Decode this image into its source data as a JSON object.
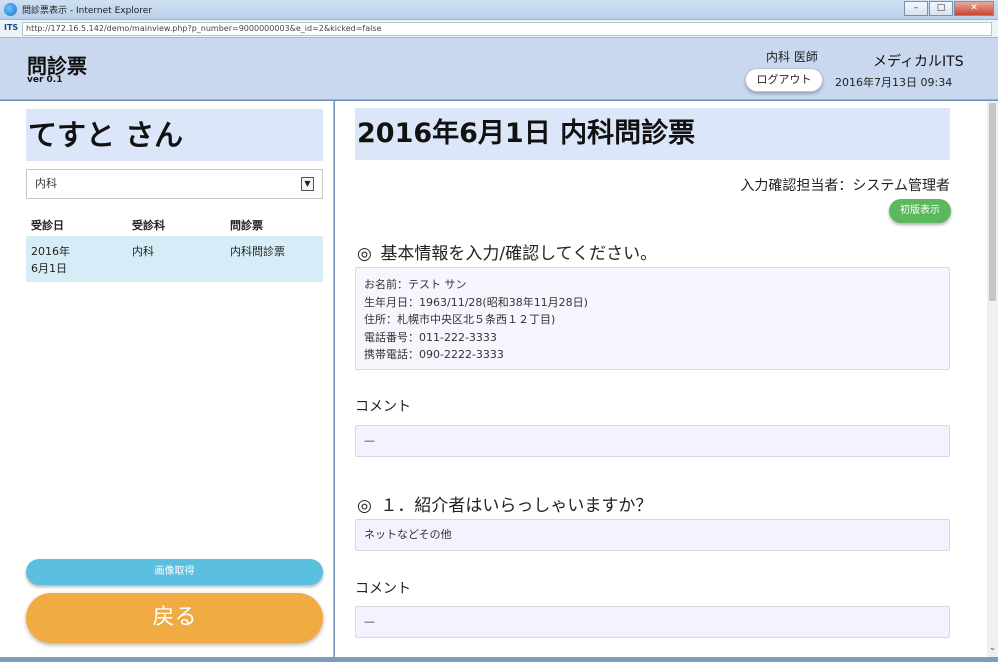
{
  "window": {
    "title": "問診票表示 - Internet Explorer",
    "minimize": "–",
    "maximize": "□",
    "close": "✕",
    "url": "http://172.16.5.142/demo/mainview.php?p_number=9000000003&e_id=2&kicked=false",
    "site_icon_text": "ITS"
  },
  "header": {
    "app_title": "問診票",
    "version": "ver 0.1",
    "user_role": "内科  医師",
    "logout_label": "ログアウト",
    "brand": "メディカルITS",
    "datetime": "2016年7月13日  09:34"
  },
  "left": {
    "patient_name": "てすと  さん",
    "department_select": "内科",
    "history_headers": [
      "受診日",
      "受診科",
      "問診票"
    ],
    "history_rows": [
      {
        "date": "2016年 6月1日",
        "department": "内科",
        "form": "内科問診票"
      }
    ],
    "image_button": "画像取得",
    "back_button": "戻る"
  },
  "main": {
    "doc_title": "2016年6月1日  内科問診票",
    "confirmer": "入力確認担当者：システム管理者",
    "first_version_button": "初版表示",
    "section_mark": "◎",
    "basic_info_title": "基本情報を入力/確認してください。",
    "basic_info": {
      "name": "お名前：テスト サン",
      "birth": "生年月日：1963/11/28(昭和38年11月28日)",
      "address": "住所：札幌市中央区北５条西１２丁目)",
      "phone": "電話番号：011-222-3333",
      "mobile": "携帯電話：090-2222-3333"
    },
    "comment_label": "コメント",
    "comment1_value": "—",
    "q1_title": "１．紹介者はいらっしゃいますか？",
    "q1_answer": "ネットなどその他",
    "comment2_value": "—"
  }
}
